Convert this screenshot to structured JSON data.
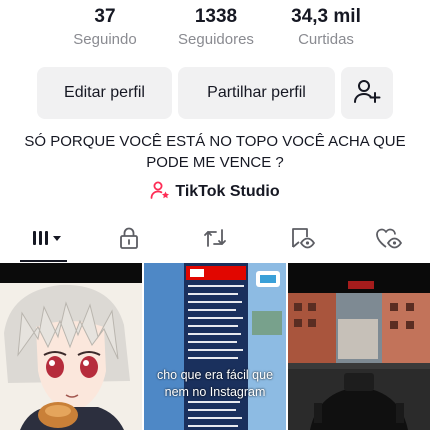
{
  "stats": [
    {
      "value": "37",
      "label": "Seguindo"
    },
    {
      "value": "1338",
      "label": "Seguidores"
    },
    {
      "value": "34,3 mil",
      "label": "Curtidas"
    }
  ],
  "buttons": {
    "edit_profile": "Editar perfil",
    "share_profile": "Partilhar perfil",
    "add_friends_icon": "person-plus-icon"
  },
  "bio": "SÓ PORQUE VOCÊ ESTÁ NO TOPO VOCÊ ACHA QUE PODE ME VENCE ?",
  "studio": {
    "label": "TikTok Studio",
    "icon": "studio-icon"
  },
  "tabs": [
    {
      "icon": "videos-grid-icon",
      "active": true
    },
    {
      "icon": "lock-icon",
      "active": false
    },
    {
      "icon": "repost-icon",
      "active": false
    },
    {
      "icon": "saved-icon",
      "active": false
    },
    {
      "icon": "liked-hidden-icon",
      "active": false
    }
  ],
  "videos": [
    {
      "caption": ""
    },
    {
      "caption_line1": "cho que era fácil que",
      "caption_line2": "nem no Instagram"
    },
    {
      "caption": ""
    }
  ],
  "colors": {
    "text": "#161823",
    "secondary_text": "#8a8b91",
    "button_bg": "#f1f1f2",
    "accent": "#fe2c55"
  }
}
